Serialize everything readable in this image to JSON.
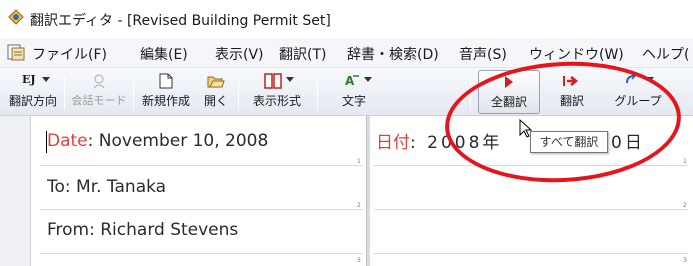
{
  "window": {
    "title": "翻訳エディタ - [Revised Building Permit Set]"
  },
  "menu": {
    "items": [
      "ファイル(F)",
      "編集(E)",
      "表示(V)",
      "翻訳(T)",
      "辞書・検索(D)",
      "音声(S)",
      "ウィンドウ(W)",
      "ヘルプ("
    ]
  },
  "toolbar": {
    "translation_direction": "翻訳方向",
    "direction_value": "EJ",
    "conversation_mode": "会話モード",
    "new_document": "新規作成",
    "open": "開く",
    "display_format": "表示形式",
    "text": "文字",
    "translate_all": "全翻訳",
    "translate": "翻訳",
    "group": "グループ"
  },
  "tooltip": {
    "text": "すべて翻訳"
  },
  "source": {
    "lines": [
      {
        "label": "Date",
        "rest": ": November 10, 2008",
        "num": "1"
      },
      {
        "label": "",
        "rest": "To: Mr. Tanaka",
        "num": "2"
      },
      {
        "label": "",
        "rest": "From: Richard Stevens",
        "num": "3"
      }
    ]
  },
  "target": {
    "label": "日付",
    "rest": ": 2008年",
    "tail": "0日",
    "nums": [
      "1",
      "2",
      "3"
    ]
  },
  "colors": {
    "highlight": "#e04040",
    "annotation": "#e8141b",
    "toolbar_top": "#f7f9fc",
    "toolbar_bottom": "#e4e9f1"
  }
}
